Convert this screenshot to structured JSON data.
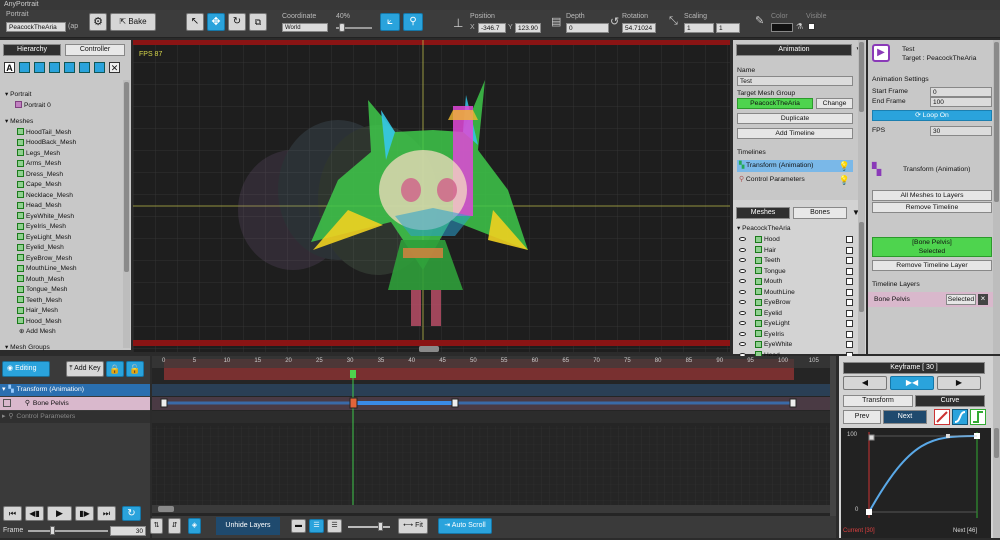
{
  "app": {
    "title": "AnyPortrait"
  },
  "toolbar": {
    "portrait_label": "Portrait",
    "portrait_name": "PeacockTheAria",
    "portrait_suffix": "(ap",
    "bake": "Bake",
    "coordinate_label": "Coordinate",
    "coordinate_value": "World",
    "zoom": "40%",
    "position_label": "Position",
    "pos_x_label": "X",
    "pos_x": "-346.7",
    "pos_y_label": "Y",
    "pos_y": "123.90",
    "depth_label": "Depth",
    "depth": "0",
    "rotation_label": "Rotation",
    "rotation": "54.71024",
    "scaling_label": "Scaling",
    "scale_x": "1",
    "scale_y": "1",
    "color_label": "Color",
    "visible_label": "Visible"
  },
  "hierarchy": {
    "tabs": [
      "Hierarchy",
      "Controller"
    ],
    "portrait_header": "Portrait",
    "portrait_item": "Portrait 0",
    "meshes_header": "Meshes",
    "meshes": [
      "HoodTail_Mesh",
      "HoodBack_Mesh",
      "Legs_Mesh",
      "Arms_Mesh",
      "Dress_Mesh",
      "Cape_Mesh",
      "Necklace_Mesh",
      "Head_Mesh",
      "EyeWhite_Mesh",
      "EyeIris_Mesh",
      "EyeLight_Mesh",
      "Eyelid_Mesh",
      "EyeBrow_Mesh",
      "MouthLine_Mesh",
      "Mouth_Mesh",
      "Tongue_Mesh",
      "Teeth_Mesh",
      "Hair_Mesh",
      "Hood_Mesh"
    ],
    "add_mesh": "Add Mesh",
    "mesh_groups": "Mesh Groups"
  },
  "viewport": {
    "fps": "FPS 87"
  },
  "animation_panel": {
    "header": "Animation",
    "name_label": "Name",
    "name_value": "Test",
    "target_label": "Target Mesh Group",
    "target_value": "PeacockTheAria",
    "change": "Change",
    "duplicate": "Duplicate",
    "add_timeline": "Add Timeline",
    "timelines_label": "Timelines",
    "timelines": [
      "Transform (Animation)",
      "Control Parameters"
    ],
    "tabs": [
      "Meshes",
      "Bones"
    ],
    "group_name": "PeacockTheAria",
    "layers": [
      "Hood",
      "Hair",
      "Teeth",
      "Tongue",
      "Mouth",
      "MouthLine",
      "EyeBrow",
      "Eyelid",
      "EyeLight",
      "EyeIris",
      "EyeWhite",
      "Head"
    ]
  },
  "right_panel": {
    "title": "Test",
    "target": "Target : PeacockTheAria",
    "settings_label": "Animation Settings",
    "start_frame_label": "Start Frame",
    "start_frame": "0",
    "end_frame_label": "End Frame",
    "end_frame": "100",
    "loop": "Loop On",
    "fps_label": "FPS",
    "fps": "30",
    "timeline_name": "Transform (Animation)",
    "all_meshes": "All Meshes to Layers",
    "remove_timeline": "Remove Timeline",
    "selected_line1": "[Bone Pelvis]",
    "selected_line2": "Selected",
    "remove_layer": "Remove Timeline Layer",
    "timeline_layers": "Timeline Layers",
    "layer_name": "Bone Pelvis",
    "layer_selected": "Selected",
    "close": "×"
  },
  "timeline": {
    "editing": "Editing",
    "add_key": "Add Key",
    "ticks": [
      "0",
      "5",
      "10",
      "15",
      "20",
      "25",
      "30",
      "35",
      "40",
      "45",
      "50",
      "55",
      "60",
      "65",
      "70",
      "75",
      "80",
      "85",
      "90",
      "95",
      "100",
      "105"
    ],
    "rows": [
      "Transform (Animation)",
      "Bone Pelvis",
      "Control Parameters"
    ],
    "unhide": "Unhide Layers",
    "fit": "Fit",
    "auto_scroll": "Auto Scroll",
    "frame_label": "Frame",
    "frame_value": "30"
  },
  "keyframe": {
    "header": "Keyframe [ 30 ]",
    "tabs": [
      "Transform",
      "Curve"
    ],
    "prev": "Prev",
    "next": "Next",
    "y100": "100",
    "y0": "0",
    "current": "Current [30]",
    "next_label": "Next [46]"
  },
  "colors": {
    "accent": "#2aa3dc",
    "green": "#4ed44e",
    "timeline_red": "#c03a3a",
    "selected_row": "#d9b8cc"
  }
}
